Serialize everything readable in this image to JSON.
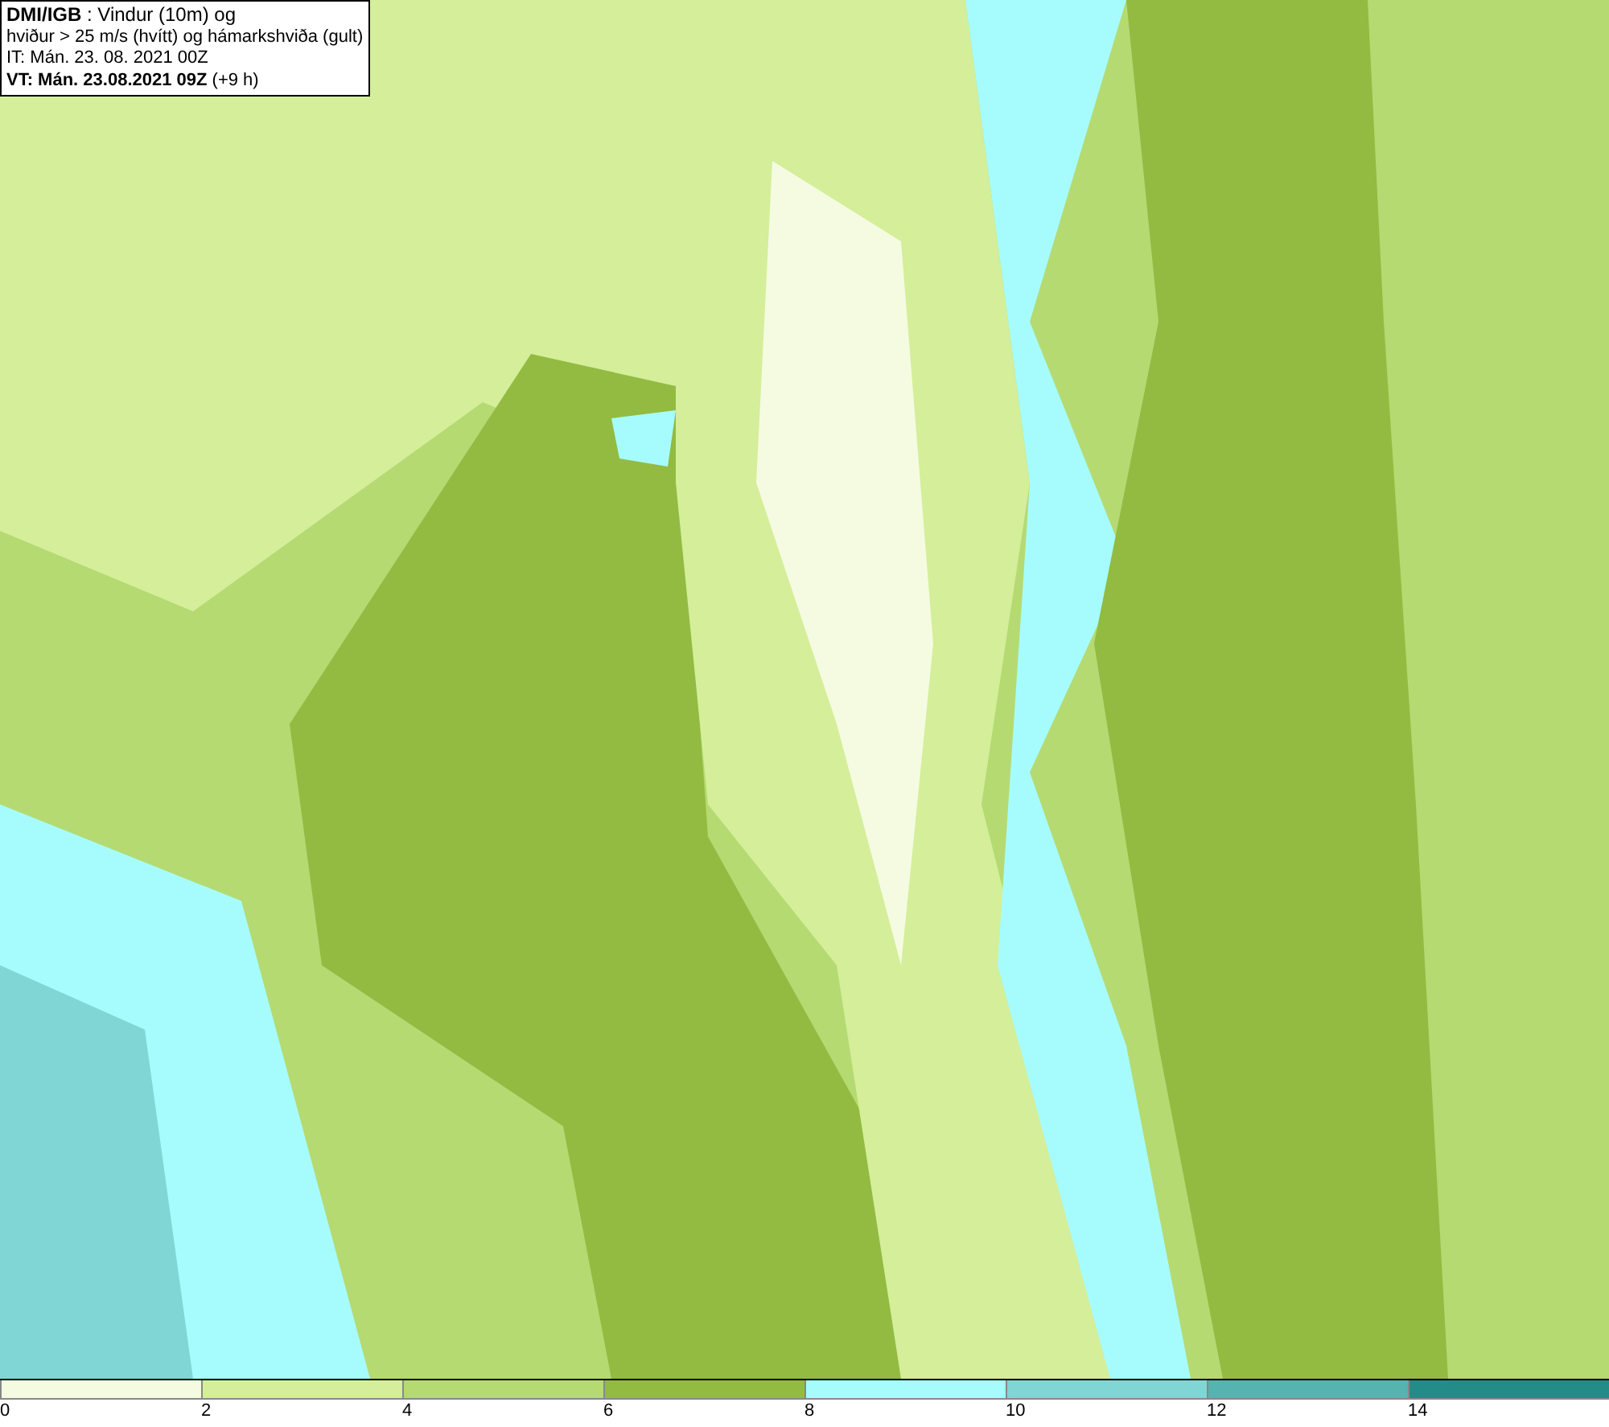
{
  "header": {
    "lines": [
      "**DMI/IGB** : Vindur (10m) og",
      "hviður > 25 m/s (hvítt) og hámarkshviða (gult)",
      "IT: Mán. 23. 08. 2021 00Z",
      "**VT: Mán. 23.08.2021 09Z** (+9 h)"
    ]
  },
  "legend": {
    "bins": [
      {
        "label": "0",
        "color": "#f5fbe0"
      },
      {
        "label": "2",
        "color": "#d4ee9a"
      },
      {
        "label": "4",
        "color": "#b5da72"
      },
      {
        "label": "6",
        "color": "#93bb42"
      },
      {
        "label": "8",
        "color": "#a6fcfc"
      },
      {
        "label": "10",
        "color": "#7fd6d4"
      },
      {
        "label": "12",
        "color": "#55b3b0"
      },
      {
        "label": "14",
        "color": "#248c88"
      }
    ]
  }
}
